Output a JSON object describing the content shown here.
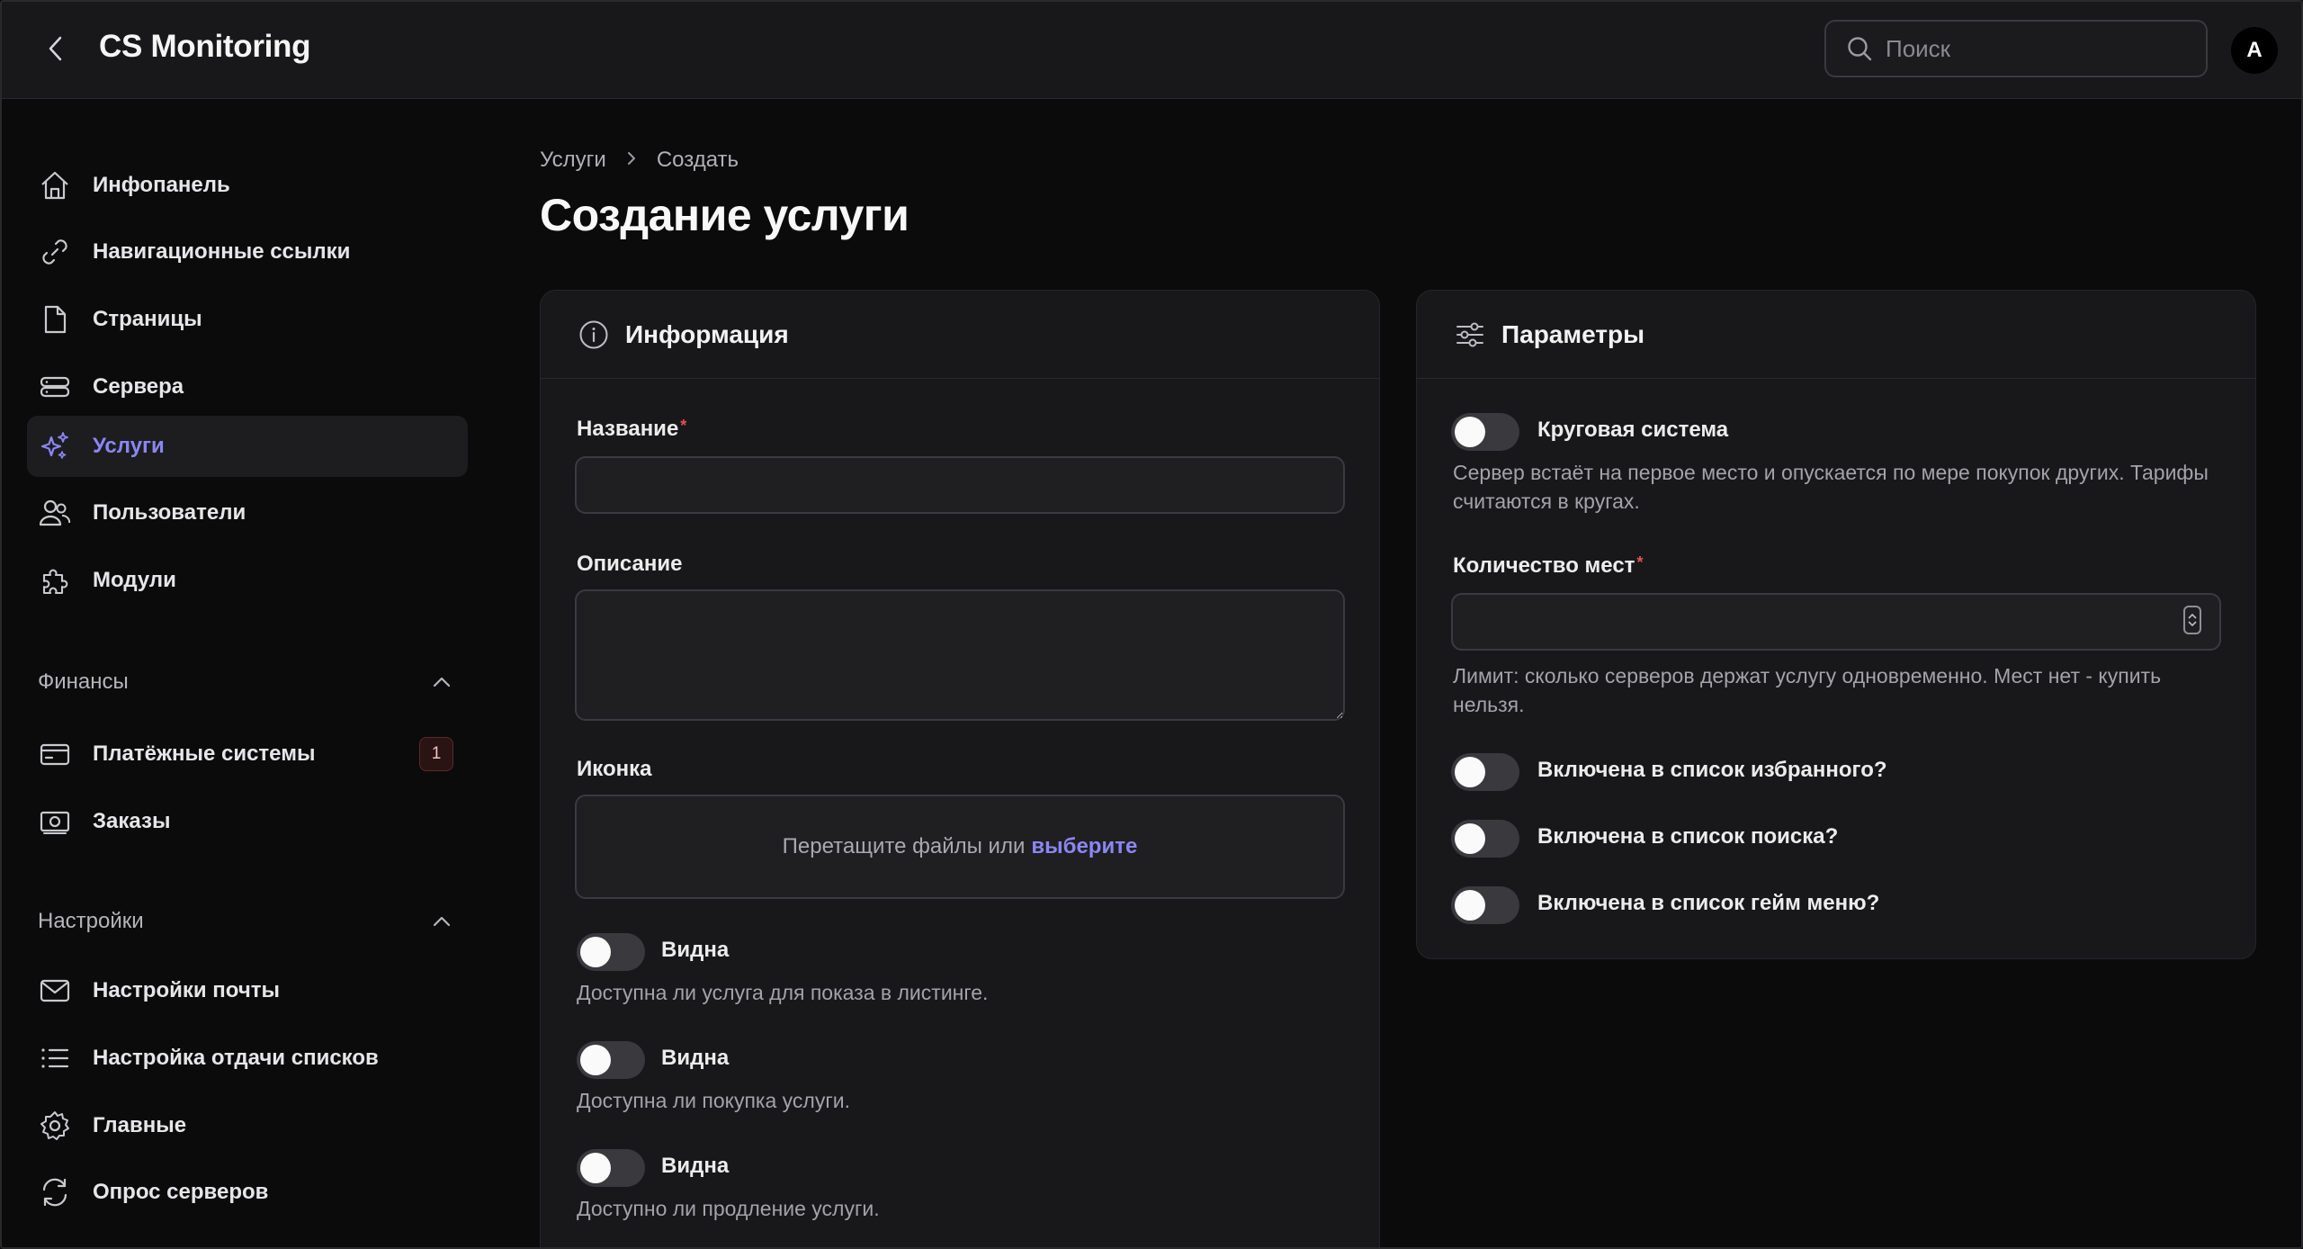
{
  "header": {
    "app_title": "CS Monitoring",
    "search_placeholder": "Поиск",
    "avatar_initial": "A"
  },
  "sidebar": {
    "items": [
      {
        "label": "Инфопанель",
        "icon": "home-icon"
      },
      {
        "label": "Навигационные ссылки",
        "icon": "link-icon"
      },
      {
        "label": "Страницы",
        "icon": "document-icon"
      },
      {
        "label": "Сервера",
        "icon": "server-icon"
      },
      {
        "label": "Услуги",
        "icon": "sparkles-icon",
        "active": true
      },
      {
        "label": "Пользователи",
        "icon": "users-icon"
      },
      {
        "label": "Модули",
        "icon": "puzzle-icon"
      }
    ],
    "groups": [
      {
        "title": "Финансы",
        "items": [
          {
            "label": "Платёжные системы",
            "icon": "credit-card-icon",
            "badge": "1"
          },
          {
            "label": "Заказы",
            "icon": "banknote-icon"
          }
        ]
      },
      {
        "title": "Настройки",
        "items": [
          {
            "label": "Настройки почты",
            "icon": "mail-icon"
          },
          {
            "label": "Настройка отдачи списков",
            "icon": "list-icon"
          },
          {
            "label": "Главные",
            "icon": "gear-icon"
          },
          {
            "label": "Опрос серверов",
            "icon": "refresh-icon"
          }
        ]
      }
    ]
  },
  "breadcrumb": {
    "parent": "Услуги",
    "current": "Создать"
  },
  "page_title": "Создание услуги",
  "info_card": {
    "title": "Информация",
    "name_label": "Название",
    "name_value": "",
    "description_label": "Описание",
    "description_value": "",
    "icon_label": "Иконка",
    "dropzone_text": "Перетащите файлы или",
    "dropzone_link": "выберите",
    "toggles": [
      {
        "label": "Видна",
        "hint": "Доступна ли услуга для показа в листинге.",
        "on": false
      },
      {
        "label": "Видна",
        "hint": "Доступна ли покупка услуги.",
        "on": false
      },
      {
        "label": "Видна",
        "hint": "Доступно ли продление услуги.",
        "on": false
      }
    ]
  },
  "params_card": {
    "title": "Параметры",
    "circular": {
      "label": "Круговая система",
      "hint": "Сервер встаёт на первое место и опускается по мере покупок других. Тарифы считаются в кругах.",
      "on": false
    },
    "slots_label": "Количество мест",
    "slots_value": "",
    "slots_hint": "Лимит: сколько серверов держат услугу одновременно. Мест нет - купить нельзя.",
    "toggles": [
      {
        "label": "Включена в список избранного?",
        "on": false
      },
      {
        "label": "Включена в список поиска?",
        "on": false
      },
      {
        "label": "Включена в список гейм меню?",
        "on": false
      }
    ]
  },
  "colors": {
    "accent": "#8b86f4",
    "background": "#0b0b0c",
    "card": "#18181a",
    "required": "#e05252"
  }
}
